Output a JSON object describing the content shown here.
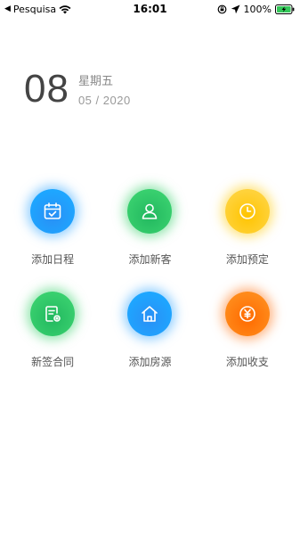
{
  "status_bar": {
    "back_glyph": "◀",
    "carrier": "Pesquisa",
    "time": "16:01",
    "battery_percent": "100%",
    "icons": [
      "wifi-icon",
      "rotation-lock-icon",
      "location-arrow-icon",
      "battery-charging-icon"
    ]
  },
  "date": {
    "day": "08",
    "weekday": "星期五",
    "month_year": "05 / 2020"
  },
  "actions": [
    {
      "label": "添加日程",
      "icon": "calendar-check-icon",
      "color": "#1ea6ff"
    },
    {
      "label": "添加新客",
      "icon": "person-icon",
      "color": "#38cf6e"
    },
    {
      "label": "添加预定",
      "icon": "clock-icon",
      "color": "#ffd23a"
    },
    {
      "label": "新签合同",
      "icon": "contract-document-icon",
      "color": "#38cf6e"
    },
    {
      "label": "添加房源",
      "icon": "house-icon",
      "color": "#1ea6ff"
    },
    {
      "label": "添加收支",
      "icon": "yuan-coin-icon",
      "color": "#ff8a1a"
    }
  ]
}
